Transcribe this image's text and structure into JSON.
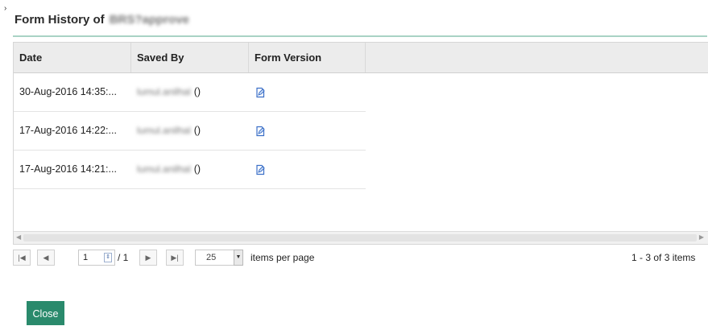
{
  "corner_mark": "›",
  "dialog": {
    "title_prefix": "Form History of",
    "title_subject": "BRS?approve"
  },
  "grid": {
    "columns": [
      "Date",
      "Saved By",
      "Form Version"
    ],
    "rows": [
      {
        "date": "30-Aug-2016 14:35:...",
        "saved_by": "lumul.anilhal",
        "saved_by_suffix": "()",
        "form_version_icon": "edit-form-icon"
      },
      {
        "date": "17-Aug-2016 14:22:...",
        "saved_by": "lumul.anilhal",
        "saved_by_suffix": "()",
        "form_version_icon": "edit-form-icon"
      },
      {
        "date": "17-Aug-2016 14:21:...",
        "saved_by": "lumul.anilhal",
        "saved_by_suffix": "()",
        "form_version_icon": "edit-form-icon"
      }
    ]
  },
  "pager": {
    "first": "|◀",
    "prev": "◀",
    "page_value": "1",
    "of_pages": "/ 1",
    "next": "▶",
    "last": "▶|",
    "items_per_page_value": "25",
    "items_per_page_label": "items per page",
    "range_info": "1 - 3 of 3 items"
  },
  "close_label": "Close",
  "colors": {
    "accent_green": "#2a8a6c",
    "title_rule": "#a9d3c5",
    "icon_blue": "#3b6fc7"
  }
}
